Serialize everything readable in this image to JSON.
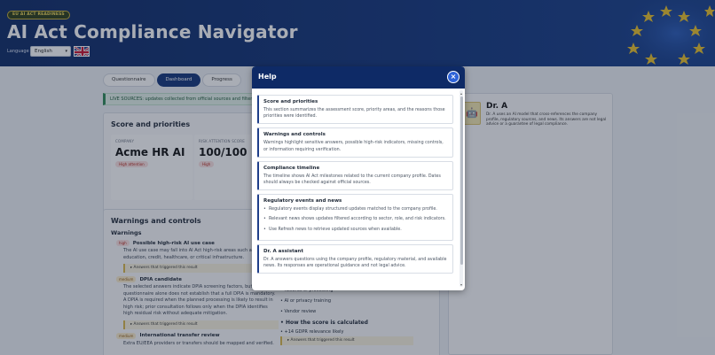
{
  "header": {
    "badge": "EU AI ACT READINESS",
    "title": "AI Act Compliance Navigator",
    "language_label": "Language",
    "language_value": "English"
  },
  "tabs": [
    {
      "label": "Questionnaire"
    },
    {
      "label": "Dashboard"
    },
    {
      "label": "Progress"
    }
  ],
  "notice": "LIVE SOURCES: updates collected from official sources and filtered",
  "score": {
    "title": "Score and priorities",
    "company_label": "COMPANY",
    "company_value": "Acme HR AI",
    "company_badge": "High attention",
    "risk_label": "RISK ATTENTION SCORE",
    "risk_value": "100/100",
    "risk_badge": "High"
  },
  "warnings": {
    "title": "Warnings and controls",
    "subtitle": "Warnings",
    "items": [
      {
        "level": "high",
        "title": "Possible high-risk AI use case",
        "text": "The AI use case may fall into AI Act high-risk areas such as education, credit, healthcare, or critical infrastructure.",
        "trigger": "Answers that triggered this result"
      },
      {
        "level": "medium",
        "title": "DPIA candidate",
        "text": "The selected answers indicate DPIA screening factors, but the questionnaire alone does not establish that a full DPIA is mandatory. A DPIA is required when the planned processing is likely to result in high risk; prior consultation follows only when the DPIA identifies high residual risk without adequate mitigation.",
        "trigger": "Answers that triggered this result"
      },
      {
        "level": "medium",
        "title": "International transfer review",
        "text": "Extra EU/EEA providers or transfers should be mapped and verified."
      }
    ],
    "right_items": [
      "Records of processing",
      "AI or privacy training",
      "Vendor review"
    ],
    "score_section": "How the score is calculated",
    "score_items": [
      "+14 GDPR relevance likely"
    ],
    "score_trigger": "Answers that triggered this result"
  },
  "dra": {
    "title": "Dr. A",
    "description": "Dr. A uses an AI model that cross-references the company profile, regulatory sources, and news. Its answers are not legal advice or a guarantee of legal compliance."
  },
  "modal": {
    "title": "Help",
    "close_symbol": "×",
    "sections": [
      {
        "title": "Score and priorities",
        "text": "This section summarizes the assessment score, priority areas, and the reasons those priorities were identified."
      },
      {
        "title": "Warnings and controls",
        "text": "Warnings highlight sensitive answers, possible high-risk indicators, missing controls, or information requiring verification."
      },
      {
        "title": "Compliance timeline",
        "text": "The timeline shows AI Act milestones related to the current company profile. Dates should always be checked against official sources."
      },
      {
        "title": "Regulatory events and news",
        "bullets": [
          "Regulatory events display structured updates matched to the company profile.",
          "Relevant news shows updates filtered according to sector, role, and risk indicators.",
          "Use Refresh news to retrieve updated sources when available."
        ]
      },
      {
        "title": "Dr. A assistant",
        "text": "Dr. A answers questions using the company profile, regulatory material, and available news. Its responses are operational guidance and not legal advice."
      }
    ]
  },
  "colors": {
    "header_bg": "#12347a",
    "accent": "#2e63d8",
    "modal_header": "#0e2a66"
  }
}
